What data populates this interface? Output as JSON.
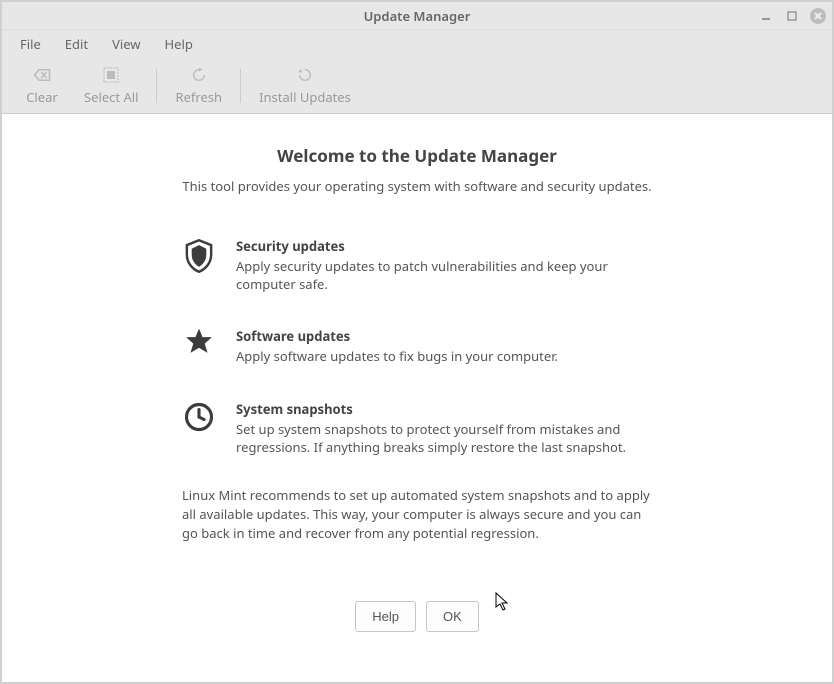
{
  "window": {
    "title": "Update Manager"
  },
  "menubar": {
    "items": [
      "File",
      "Edit",
      "View",
      "Help"
    ]
  },
  "toolbar": {
    "clear": "Clear",
    "select_all": "Select All",
    "refresh": "Refresh",
    "install_updates": "Install Updates"
  },
  "welcome": {
    "title": "Welcome to the Update Manager",
    "subtitle": "This tool provides your operating system with software and security updates."
  },
  "features": [
    {
      "icon": "shield-icon",
      "title": "Security updates",
      "body": "Apply security updates to patch vulnerabilities and keep your computer safe."
    },
    {
      "icon": "star-icon",
      "title": "Software updates",
      "body": "Apply software updates to fix bugs in your computer."
    },
    {
      "icon": "clock-icon",
      "title": "System snapshots",
      "body": "Set up system snapshots to protect yourself from mistakes and regressions. If anything breaks simply restore the last snapshot."
    }
  ],
  "recommend": "Linux Mint recommends to set up automated system snapshots and to apply all available updates. This way, your computer is always secure and you can go back in time and recover from any potential regression.",
  "buttons": {
    "help": "Help",
    "ok": "OK"
  }
}
